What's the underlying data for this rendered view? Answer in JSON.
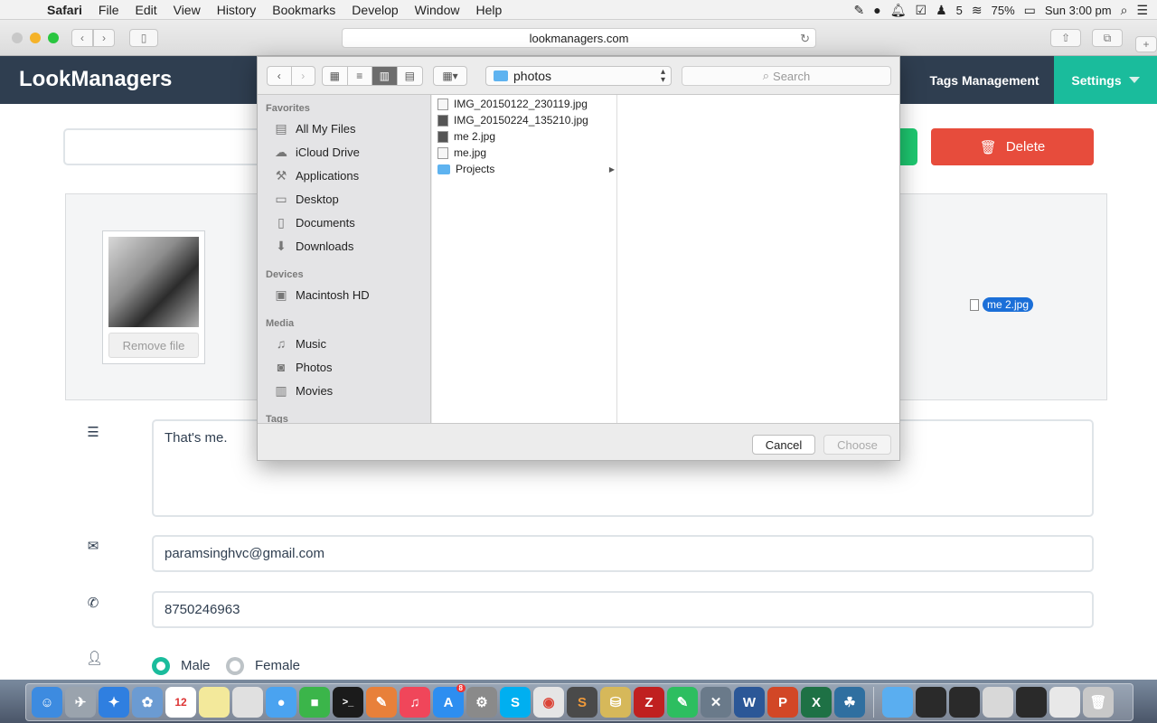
{
  "menubar": {
    "app": "Safari",
    "items": [
      "File",
      "Edit",
      "View",
      "History",
      "Bookmarks",
      "Develop",
      "Window",
      "Help"
    ],
    "notification_count": "5",
    "battery": "75%",
    "clock": "Sun 3:00 pm"
  },
  "browser": {
    "url": "lookmanagers.com"
  },
  "site": {
    "logo": "LookManagers",
    "nav_tags": "Tags Management",
    "nav_settings": "Settings",
    "delete_label": "Delete",
    "remove_file_label": "Remove file",
    "dragged_file": "me 2.jpg",
    "bio": "That's me.",
    "email": "paramsinghvc@gmail.com",
    "phone": "8750246963",
    "gender_male": "Male",
    "gender_female": "Female",
    "gender_selected": "Male"
  },
  "dialog": {
    "location": "photos",
    "search_placeholder": "Search",
    "sidebar": {
      "favorites_heading": "Favorites",
      "favorites": [
        "All My Files",
        "iCloud Drive",
        "Applications",
        "Desktop",
        "Documents",
        "Downloads"
      ],
      "devices_heading": "Devices",
      "devices": [
        "Macintosh HD"
      ],
      "media_heading": "Media",
      "media": [
        "Music",
        "Photos",
        "Movies"
      ],
      "tags_heading": "Tags"
    },
    "files": [
      "IMG_20150122_230119.jpg",
      "IMG_20150224_135210.jpg",
      "me 2.jpg",
      "me.jpg",
      "Projects"
    ],
    "cancel_label": "Cancel",
    "choose_label": "Choose"
  },
  "dock": {
    "calendar_day": "12",
    "appstore_badge": "8"
  },
  "colors": {
    "header": "#2f3e50",
    "accent": "#1abc9c",
    "danger": "#e74c3c",
    "success": "#1ec870"
  }
}
